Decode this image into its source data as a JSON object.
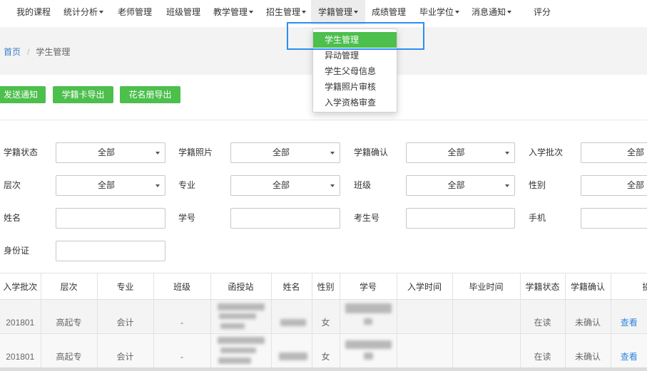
{
  "nav": {
    "items": [
      {
        "label": "我的课程"
      },
      {
        "label": "统计分析",
        "icon": "caret-down-icon"
      },
      {
        "label": "老师管理"
      },
      {
        "label": "班级管理"
      },
      {
        "label": "教学管理",
        "icon": "caret-down-icon"
      },
      {
        "label": "招生管理",
        "icon": "caret-down-icon"
      },
      {
        "label": "学籍管理",
        "icon": "caret-down-icon"
      },
      {
        "label": "成绩管理"
      },
      {
        "label": "毕业学位",
        "icon": "caret-down-icon"
      },
      {
        "label": "消息通知",
        "icon": "caret-down-icon"
      },
      {
        "label": "评分"
      }
    ]
  },
  "dropdown": {
    "items": [
      {
        "label": "学生管理"
      },
      {
        "label": "异动管理"
      },
      {
        "label": "学生父母信息"
      },
      {
        "label": "学籍照片审核"
      },
      {
        "label": "入学资格审查"
      }
    ]
  },
  "breadcrumb": {
    "home": "首页",
    "separator": "/",
    "current": "学生管理"
  },
  "toolbar": {
    "buttons": [
      {
        "label": "发送通知"
      },
      {
        "label": "学籍卡导出"
      },
      {
        "label": "花名册导出"
      }
    ]
  },
  "filters": {
    "student_status": {
      "label": "学籍状态",
      "value": "全部"
    },
    "photo": {
      "label": "学籍照片",
      "value": "全部"
    },
    "confirmation": {
      "label": "学籍确认",
      "value": "全部"
    },
    "batch": {
      "label": "入学批次",
      "value": "全部"
    },
    "level": {
      "label": "层次",
      "value": "全部"
    },
    "major": {
      "label": "专业",
      "value": "全部"
    },
    "class": {
      "label": "班级",
      "value": "全部"
    },
    "gender": {
      "label": "性别",
      "value": "全部"
    },
    "name": {
      "label": "姓名",
      "value": ""
    },
    "student_id": {
      "label": "学号",
      "value": ""
    },
    "exam_no": {
      "label": "考生号",
      "value": ""
    },
    "phone": {
      "label": "手机",
      "value": ""
    },
    "id_card": {
      "label": "身份证",
      "value": ""
    }
  },
  "table": {
    "headers": [
      "入学批次",
      "层次",
      "专业",
      "班级",
      "函授站",
      "姓名",
      "性别",
      "学号",
      "入学时间",
      "毕业时间",
      "学籍状态",
      "学籍确认",
      "操作"
    ],
    "rows": [
      {
        "batch": "201801",
        "level": "高起专",
        "major": "会计",
        "class": "-",
        "gender": "女",
        "status": "在读",
        "confirmation": "未确认",
        "action": "查看"
      },
      {
        "batch": "201801",
        "level": "高起专",
        "major": "会计",
        "class": "-",
        "gender": "女",
        "status": "在读",
        "confirmation": "未确认",
        "action": "查看"
      }
    ]
  },
  "colors": {
    "accent_green": "#4cbf4c",
    "link_blue": "#2e86de",
    "annotation_blue": "#2b8ff0",
    "nav_active_bg": "#ececec"
  }
}
